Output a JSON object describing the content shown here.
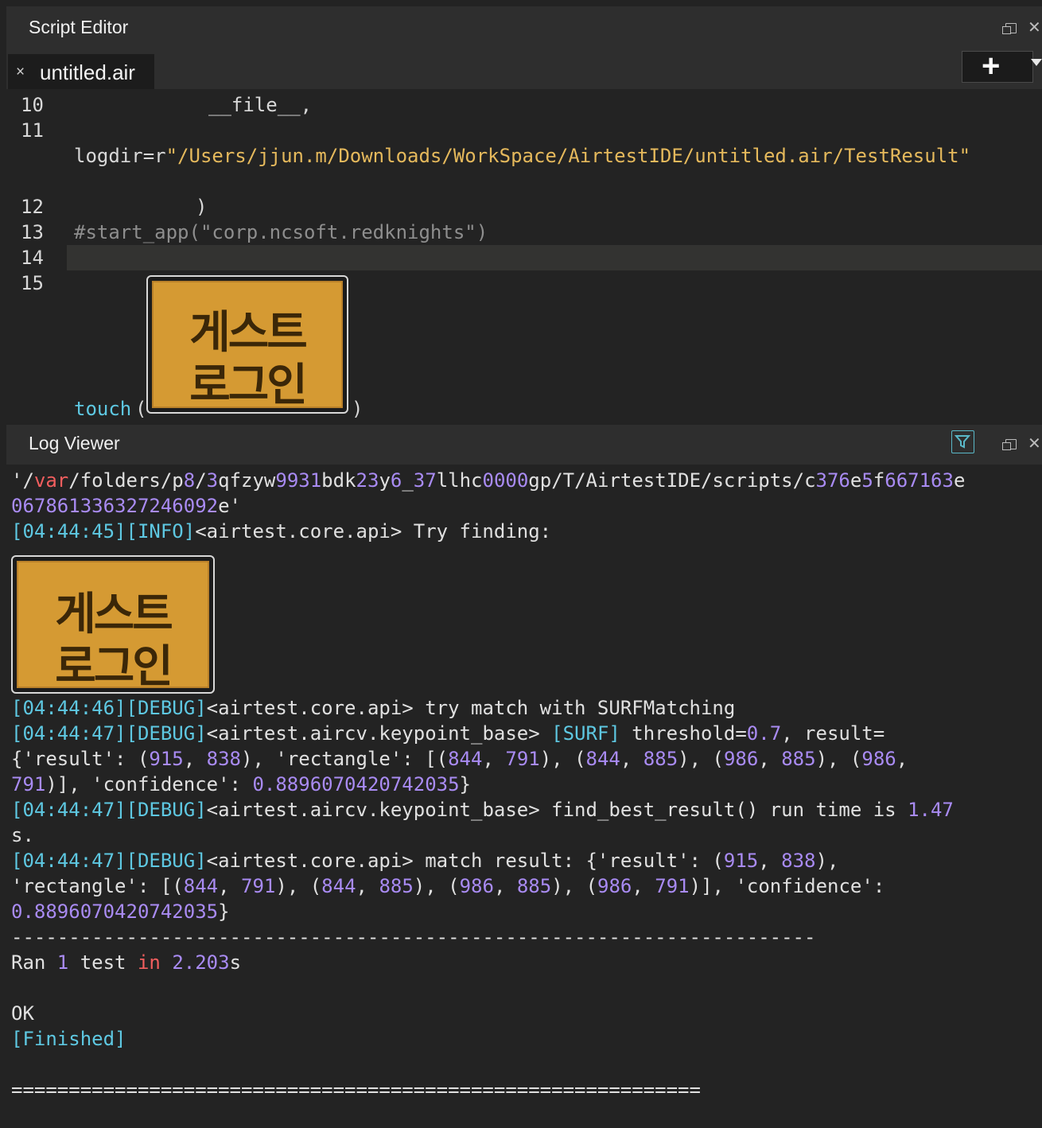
{
  "editor": {
    "title": "Script Editor",
    "tab": {
      "label": "untitled.air",
      "close": "×"
    },
    "add_button": "+",
    "lines": {
      "l10": {
        "num": "10",
        "text": "__file__,"
      },
      "l11": {
        "num": "11",
        "prefix": "logdir=r",
        "string": "\"/Users/jjun.m/Downloads/WorkSpace/AirtestIDE/untitled.air/TestResult\""
      },
      "l12": {
        "num": "12",
        "text": ")"
      },
      "l13": {
        "num": "13",
        "text": "#start_app(\"corp.ncsoft.redknights\")"
      },
      "l14": {
        "num": "14"
      },
      "l15": {
        "num": "15",
        "fn": "touch",
        "open": "(",
        "close": ")"
      }
    },
    "touch_image": {
      "line1": "게스트",
      "line2": "로그인"
    }
  },
  "log_viewer": {
    "title": "Log Viewer",
    "path_line1": {
      "a": "'/",
      "b": "var",
      "c": "/folders/p",
      "d": "8",
      "e": "/",
      "f": "3",
      "g": "qfzyw",
      "h": "9931",
      "i": "bdk",
      "j": "23",
      "k": "y",
      "l": "6",
      "m": "_",
      "n": "37",
      "o": "llhc",
      "p": "0000",
      "q": "gp/T/AirtestIDE/scripts/c",
      "r": "376",
      "s": "e",
      "t": "5",
      "u": "f",
      "v": "667163",
      "w": "e"
    },
    "path_line2": {
      "num": "067861336327246092",
      "tail": "e'"
    },
    "try_finding": {
      "ts": "[04:44:45]",
      "level": "[INFO]",
      "msg": "<airtest.core.api> Try finding:"
    },
    "found_image": {
      "line1": "게스트",
      "line2": "로그인"
    },
    "try_match": {
      "ts": "[04:44:46]",
      "level": "[DEBUG]",
      "msg": "<airtest.core.api> try match with SURFMatching"
    },
    "surf": {
      "ts": "[04:44:47]",
      "level": "[DEBUG]",
      "msg": "<airtest.aircv.keypoint_base> ",
      "tag": "[SURF]",
      "m2": " threshold=",
      "threshold": "0.7",
      "m3": ", result=",
      "l2a": "{'result': (",
      "x": "915",
      "sep1": ", ",
      "y": "838",
      "l2b": "), 'rectangle': [(",
      "r1": "844",
      "sep2": ", ",
      "r2": "791",
      "l2c": "), (",
      "r3": "844",
      "sep3": ", ",
      "r4": "885",
      "l2d": "), (",
      "r5": "986",
      "sep4": ", ",
      "r6": "885",
      "l2e": "), (",
      "r7": "986",
      "l2f": ",",
      "r8": "791",
      "l3a": ")], 'confidence': ",
      "conf": "0.8896070420742035",
      "l3b": "}"
    },
    "best": {
      "ts": "[04:44:47]",
      "level": "[DEBUG]",
      "msg": "<airtest.aircv.keypoint_base> find_best_result() run time is ",
      "time": "1.47",
      "unit": "s."
    },
    "match": {
      "ts": "[04:44:47]",
      "level": "[DEBUG]",
      "msg": "<airtest.core.api> match result: {'result': (",
      "x": "915",
      "sep": ", ",
      "y": "838",
      "end": "),",
      "l2a": "'rectangle': [(",
      "r1": "844",
      "s1": ", ",
      "r2": "791",
      "l2b": "), (",
      "r3": "844",
      "s2": ", ",
      "r4": "885",
      "l2c": "), (",
      "r5": "986",
      "s3": ", ",
      "r6": "885",
      "l2d": "), (",
      "r7": "986",
      "s4": ", ",
      "r8": "791",
      "l2e": ")], 'confidence':",
      "conf": "0.8896070420742035",
      "l3b": "}"
    },
    "dashes": "----------------------------------------------------------------------",
    "ran": {
      "a": "Ran ",
      "count": "1",
      "b": " test ",
      "in": "in",
      "c": " ",
      "secs": "2.203",
      "d": "s"
    },
    "ok": "OK",
    "finished": "[Finished]",
    "equals": "============================================================"
  }
}
